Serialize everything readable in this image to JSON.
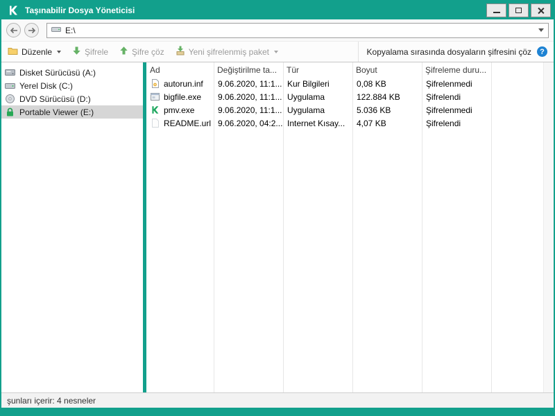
{
  "window": {
    "title": "Taşınabilir Dosya Yöneticisi"
  },
  "nav": {
    "address": "E:\\"
  },
  "toolbar": {
    "organize_label": "Düzenle",
    "encrypt_label": "Şifrele",
    "decrypt_label": "Şifre çöz",
    "new_package_label": "Yeni şifrelenmiş paket",
    "decrypt_on_copy_label": "Kopyalama sırasında dosyaların şifresini çöz",
    "info_glyph": "?"
  },
  "sidebar": {
    "items": [
      {
        "label": "Disket Sürücüsü (A:)"
      },
      {
        "label": "Yerel Disk (C:)"
      },
      {
        "label": "DVD Sürücüsü (D:)"
      },
      {
        "label": "Portable Viewer (E:)"
      }
    ]
  },
  "filelist": {
    "columns": [
      "Ad",
      "Değiştirilme ta...",
      "Tür",
      "Boyut",
      "Şifreleme duru..."
    ],
    "rows": [
      {
        "name": "autorun.inf",
        "modified": "9.06.2020, 11:1...",
        "type": "Kur Bilgileri",
        "size": "0,08 KB",
        "status": "Şifrelenmedi"
      },
      {
        "name": "bigfile.exe",
        "modified": "9.06.2020, 11:1...",
        "type": "Uygulama",
        "size": "122.884 KB",
        "status": "Şifrelendi"
      },
      {
        "name": "pmv.exe",
        "modified": "9.06.2020, 11:1...",
        "type": "Uygulama",
        "size": "5.036 KB",
        "status": "Şifrelenmedi"
      },
      {
        "name": "README.url",
        "modified": "9.06.2020, 04:2...",
        "type": "Internet Kısay...",
        "size": "4,07 KB",
        "status": "Şifrelendi"
      }
    ]
  },
  "statusbar": {
    "text": "şunları içerir: 4 nesneler"
  },
  "colors": {
    "teal": "#12a08c",
    "toolbar_green": "#66b266",
    "info_blue": "#1e83d3",
    "selection_gray": "#d6d6d6"
  }
}
